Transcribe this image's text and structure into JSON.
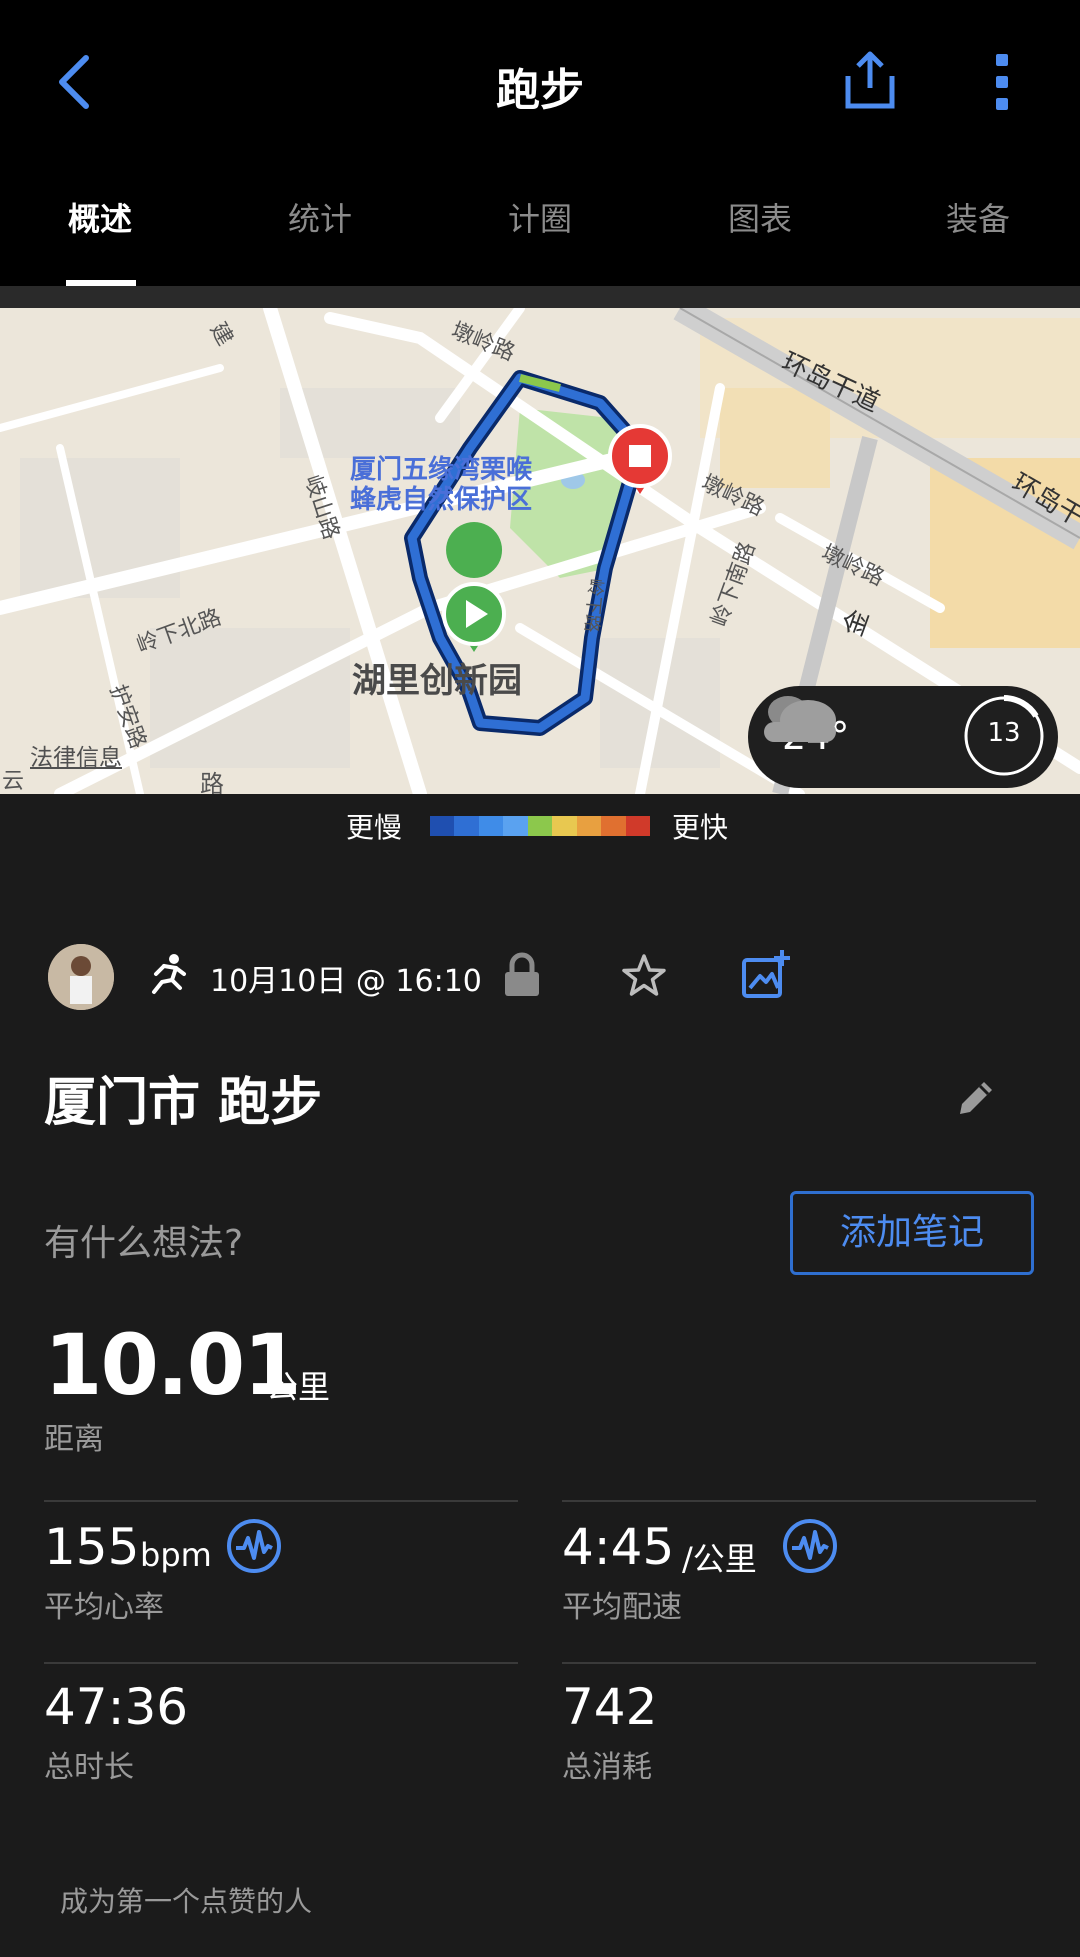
{
  "header": {
    "title": "跑步",
    "icons": {
      "back": "chevron-left-icon",
      "share": "share-icon",
      "more": "more-vertical-icon"
    },
    "accent": "#4d8cf0"
  },
  "tabs": [
    {
      "label": "概述",
      "active": true
    },
    {
      "label": "统计",
      "active": false
    },
    {
      "label": "计圈",
      "active": false
    },
    {
      "label": "图表",
      "active": false
    },
    {
      "label": "装备",
      "active": false
    }
  ],
  "map": {
    "labels": {
      "reserve": "厦门五缘湾栗喉\n蜂虎自然保护区",
      "reserve_line1": "厦门五缘湾栗喉",
      "reserve_line2": "蜂虎自然保护区",
      "park": "湖里创新园",
      "road_huandao1": "环岛干道",
      "road_huandao2": "环岛干",
      "road_dunling1": "墩岭路",
      "road_dunling2": "墩岭路",
      "road_dunling3": "墩岭路",
      "road_qishan": "岐山路",
      "road_lingxia": "岭下路",
      "road_lingxiabei": "岭下北路",
      "road_lingxianan": "岭下南路",
      "road_hu_an": "护安路",
      "road_jin": "金",
      "road_jian": "建",
      "road_yun": "云",
      "road_lu": "路"
    },
    "legal": "法律信息",
    "weather": {
      "temperature": "24°",
      "icon": "cloudy-icon",
      "uv": "13"
    }
  },
  "pace_legend": {
    "slow": "更慢",
    "fast": "更快",
    "colors": [
      "#1f4fb0",
      "#2f6fd4",
      "#3f8ce8",
      "#5aa2f0",
      "#8cc84c",
      "#e8c850",
      "#e8a040",
      "#e07030",
      "#d03a2a"
    ]
  },
  "activity": {
    "date": "10月10日 @ 16:10",
    "name": "厦门市 跑步",
    "thoughts_placeholder": "有什么想法?",
    "add_note_label": "添加笔记"
  },
  "stats": {
    "distance": {
      "value": "10.01",
      "unit": "公里",
      "label": "距离"
    },
    "avg_hr": {
      "value": "155",
      "unit": "bpm",
      "label": "平均心率"
    },
    "avg_pace": {
      "value": "4:45",
      "unit": "/公里",
      "label": "平均配速"
    },
    "duration": {
      "value": "47:36",
      "label": "总时长"
    },
    "calories": {
      "value": "742",
      "label": "总消耗"
    }
  },
  "kudos": "成为第一个点赞的人"
}
